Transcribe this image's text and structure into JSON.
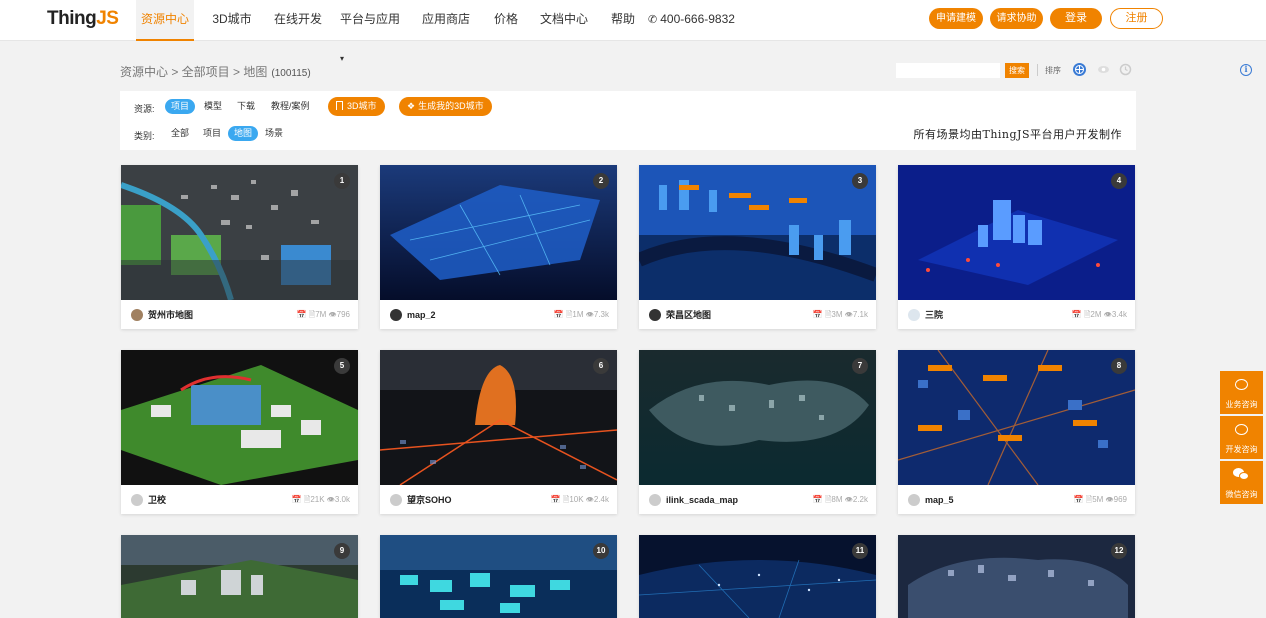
{
  "header": {
    "logo_main": "Thing",
    "logo_accent": "JS",
    "nav": [
      "资源中心",
      "3D城市",
      "在线开发",
      "平台与应用",
      "应用商店",
      "价格",
      "文档中心",
      "帮助"
    ],
    "platform_caret": "▾",
    "phone": "400-666-9832",
    "btn_apply_model": "申请建模",
    "btn_request_help": "请求协助",
    "btn_login": "登录",
    "btn_register": "注册"
  },
  "breadcrumb": {
    "text": "资源中心 > 全部项目 > 地图",
    "count": "(100115)"
  },
  "toolbar": {
    "search_btn": "搜索",
    "sort_label": "排序",
    "info": "i"
  },
  "filter": {
    "resource_label": "资源:",
    "resource_items": [
      "项目",
      "模型",
      "下载",
      "教程/案例"
    ],
    "btn_3d_city": "3D城市",
    "btn_gen_city": "生成我的3D城市",
    "category_label": "类别:",
    "category_items": [
      "全部",
      "项目",
      "地图",
      "场景"
    ],
    "notice": "所有场景均由ThingJS平台用户开发制作"
  },
  "cards": [
    {
      "num": "1",
      "name": "贺州市地图",
      "size": "7M",
      "views": "796"
    },
    {
      "num": "2",
      "name": "map_2",
      "size": "1M",
      "views": "7.3k"
    },
    {
      "num": "3",
      "name": "荣昌区地图",
      "size": "3M",
      "views": "7.1k"
    },
    {
      "num": "4",
      "name": "三院",
      "size": "2M",
      "views": "3.4k"
    },
    {
      "num": "5",
      "name": "卫校",
      "size": "21K",
      "views": "3.0k"
    },
    {
      "num": "6",
      "name": "望京SOHO",
      "size": "10K",
      "views": "2.4k"
    },
    {
      "num": "7",
      "name": "ilink_scada_map",
      "size": "8M",
      "views": "2.2k"
    },
    {
      "num": "8",
      "name": "map_5",
      "size": "5M",
      "views": "969"
    },
    {
      "num": "9",
      "name": "",
      "size": "",
      "views": ""
    },
    {
      "num": "10",
      "name": "",
      "size": "",
      "views": ""
    },
    {
      "num": "11",
      "name": "",
      "size": "",
      "views": ""
    },
    {
      "num": "12",
      "name": "",
      "size": "",
      "views": ""
    }
  ],
  "side": {
    "business": "业务咨询",
    "dev": "开发咨询",
    "wechat": "微信咨询"
  },
  "colors": {
    "accent": "#f08300",
    "select_blue": "#3aa8f0"
  }
}
